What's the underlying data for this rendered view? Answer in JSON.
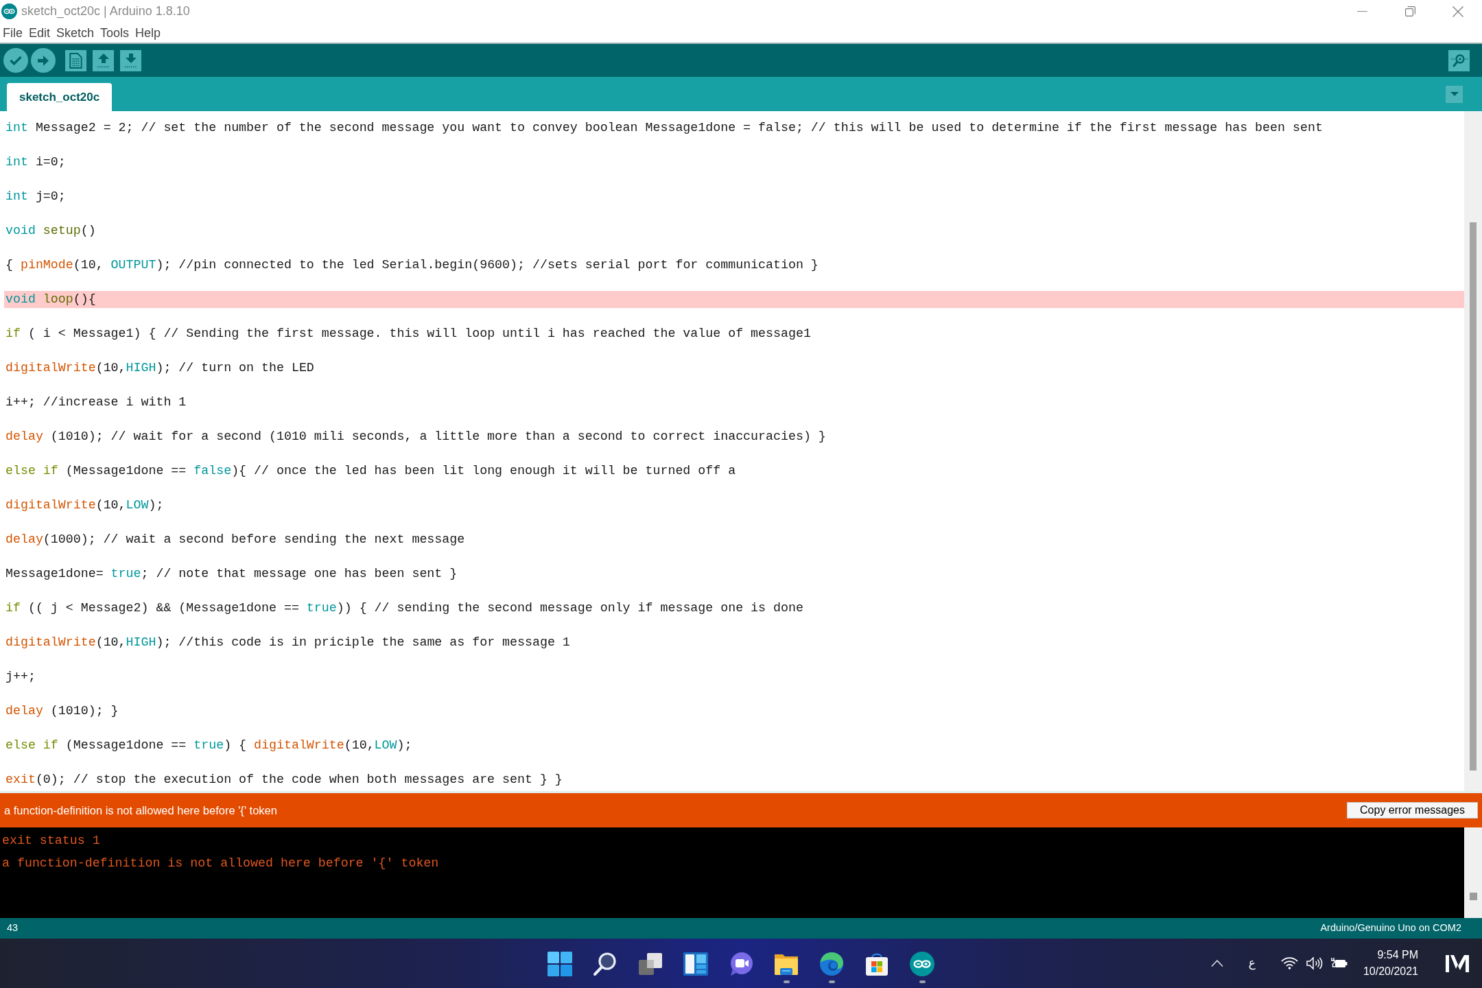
{
  "window": {
    "title": "sketch_oct20c | Arduino 1.8.10"
  },
  "menu": [
    "File",
    "Edit",
    "Sketch",
    "Tools",
    "Help"
  ],
  "tabs": [
    {
      "label": "sketch_oct20c",
      "selected": true
    }
  ],
  "code": {
    "lines": [
      {
        "highlighted": false,
        "tokens": [
          {
            "kind": "type",
            "text": "int"
          },
          {
            "kind": "text",
            "text": " Message2 = 2; // set the number of the second message you want to convey boolean Message1done = false; // this will be used to determine if the first message has been sent"
          }
        ]
      },
      {
        "highlighted": false,
        "tokens": [
          {
            "kind": "type",
            "text": "int"
          },
          {
            "kind": "text",
            "text": " i=0;"
          }
        ]
      },
      {
        "highlighted": false,
        "tokens": [
          {
            "kind": "type",
            "text": "int"
          },
          {
            "kind": "text",
            "text": " j=0;"
          }
        ]
      },
      {
        "highlighted": false,
        "tokens": [
          {
            "kind": "type",
            "text": "void"
          },
          {
            "kind": "structure",
            "text": " setup"
          },
          {
            "kind": "text",
            "text": "()"
          }
        ]
      },
      {
        "highlighted": false,
        "tokens": [
          {
            "kind": "text",
            "text": "{ "
          },
          {
            "kind": "function",
            "text": "pinMode"
          },
          {
            "kind": "text",
            "text": "(10, "
          },
          {
            "kind": "constant",
            "text": "OUTPUT"
          },
          {
            "kind": "text",
            "text": "); //pin connected to the led Serial.begin(9600); //sets serial port for communication }"
          }
        ]
      },
      {
        "highlighted": true,
        "tokens": [
          {
            "kind": "type",
            "text": "void"
          },
          {
            "kind": "structure",
            "text": " loop"
          },
          {
            "kind": "text",
            "text": "(){"
          }
        ]
      },
      {
        "highlighted": false,
        "tokens": [
          {
            "kind": "control",
            "text": "if"
          },
          {
            "kind": "text",
            "text": " ( i < Message1) { // Sending the first message. this will loop until i has reached the value of message1"
          }
        ]
      },
      {
        "highlighted": false,
        "tokens": [
          {
            "kind": "function",
            "text": "digitalWrite"
          },
          {
            "kind": "text",
            "text": "(10,"
          },
          {
            "kind": "constant",
            "text": "HIGH"
          },
          {
            "kind": "text",
            "text": "); // turn on the LED"
          }
        ]
      },
      {
        "highlighted": false,
        "tokens": [
          {
            "kind": "text",
            "text": "i++; //increase i with 1"
          }
        ]
      },
      {
        "highlighted": false,
        "tokens": [
          {
            "kind": "function",
            "text": "delay"
          },
          {
            "kind": "text",
            "text": " (1010); // wait for a second (1010 mili seconds, a little more than a second to correct inaccuracies) }"
          }
        ]
      },
      {
        "highlighted": false,
        "tokens": [
          {
            "kind": "control",
            "text": "else if"
          },
          {
            "kind": "text",
            "text": " (Message1done == "
          },
          {
            "kind": "constant",
            "text": "false"
          },
          {
            "kind": "text",
            "text": "){ // once the led has been lit long enough it will be turned off a"
          }
        ]
      },
      {
        "highlighted": false,
        "tokens": [
          {
            "kind": "function",
            "text": "digitalWrite"
          },
          {
            "kind": "text",
            "text": "(10,"
          },
          {
            "kind": "constant",
            "text": "LOW"
          },
          {
            "kind": "text",
            "text": ");"
          }
        ]
      },
      {
        "highlighted": false,
        "tokens": [
          {
            "kind": "function",
            "text": "delay"
          },
          {
            "kind": "text",
            "text": "(1000); // wait a second before sending the next message"
          }
        ]
      },
      {
        "highlighted": false,
        "tokens": [
          {
            "kind": "text",
            "text": "Message1done= "
          },
          {
            "kind": "constant",
            "text": "true"
          },
          {
            "kind": "text",
            "text": "; // note that message one has been sent }"
          }
        ]
      },
      {
        "highlighted": false,
        "tokens": [
          {
            "kind": "control",
            "text": "if"
          },
          {
            "kind": "text",
            "text": " (( j < Message2) && (Message1done == "
          },
          {
            "kind": "constant",
            "text": "true"
          },
          {
            "kind": "text",
            "text": ")) { // sending the second message only if message one is done"
          }
        ]
      },
      {
        "highlighted": false,
        "tokens": [
          {
            "kind": "function",
            "text": "digitalWrite"
          },
          {
            "kind": "text",
            "text": "(10,"
          },
          {
            "kind": "constant",
            "text": "HIGH"
          },
          {
            "kind": "text",
            "text": "); //this code is in priciple the same as for message 1"
          }
        ]
      },
      {
        "highlighted": false,
        "tokens": [
          {
            "kind": "text",
            "text": "j++;"
          }
        ]
      },
      {
        "highlighted": false,
        "tokens": [
          {
            "kind": "function",
            "text": "delay"
          },
          {
            "kind": "text",
            "text": " (1010); }"
          }
        ]
      },
      {
        "highlighted": false,
        "tokens": [
          {
            "kind": "control",
            "text": "else if"
          },
          {
            "kind": "text",
            "text": " (Message1done == "
          },
          {
            "kind": "constant",
            "text": "true"
          },
          {
            "kind": "text",
            "text": ") { "
          },
          {
            "kind": "function",
            "text": "digitalWrite"
          },
          {
            "kind": "text",
            "text": "(10,"
          },
          {
            "kind": "constant",
            "text": "LOW"
          },
          {
            "kind": "text",
            "text": ");"
          }
        ]
      },
      {
        "highlighted": false,
        "tokens": [
          {
            "kind": "function",
            "text": "exit"
          },
          {
            "kind": "text",
            "text": "(0); // stop the execution of the code when both messages are sent } }"
          }
        ]
      }
    ]
  },
  "error_bar": {
    "message": "a function-definition is not allowed here before '{' token",
    "button": "Copy error messages"
  },
  "console": {
    "lines": [
      "exit status 1",
      "a function-definition is not allowed here before '{' token"
    ]
  },
  "status_bar": {
    "line_number": "43",
    "board": "Arduino/Genuino Uno on COM2"
  },
  "taskbar": {
    "apps": [
      {
        "kind": "start",
        "running": false
      },
      {
        "kind": "search",
        "running": false
      },
      {
        "kind": "task-view",
        "running": false
      },
      {
        "kind": "widgets",
        "running": false
      },
      {
        "kind": "chat",
        "running": false
      },
      {
        "kind": "explorer",
        "running": true
      },
      {
        "kind": "edge",
        "running": true
      },
      {
        "kind": "store",
        "running": false
      },
      {
        "kind": "arduino",
        "running": true
      }
    ],
    "tray": {
      "language": "ع",
      "time": "9:54 PM",
      "date": "10/20/2021"
    }
  }
}
